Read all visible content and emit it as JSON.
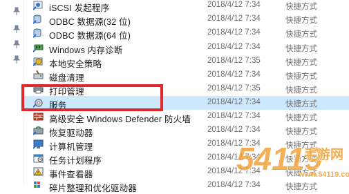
{
  "nav": {
    "pins": [
      "pin-icon",
      "pin-icon",
      "pin-icon",
      "pin-icon"
    ]
  },
  "files": [
    {
      "name": "iSCSI 发起程序",
      "date": "2018/4/12 7:34",
      "type": "快捷方式",
      "icon": "iscsi-icon",
      "selected": false
    },
    {
      "name": "ODBC 数据源(32 位)",
      "date": "2018/4/12 7:34",
      "type": "快捷方式",
      "icon": "odbc-icon",
      "selected": false
    },
    {
      "name": "ODBC 数据源(64 位)",
      "date": "2018/4/12 7:34",
      "type": "快捷方式",
      "icon": "odbc-icon",
      "selected": false
    },
    {
      "name": "Windows 内存诊断",
      "date": "2018/4/12 7:34",
      "type": "快捷方式",
      "icon": "memory-diagnostic-icon",
      "selected": false
    },
    {
      "name": "本地安全策略",
      "date": "2018/4/12 7:35",
      "type": "快捷方式",
      "icon": "security-policy-icon",
      "selected": false
    },
    {
      "name": "磁盘清理",
      "date": "2018/4/12 7:34",
      "type": "快捷方式",
      "icon": "disk-cleanup-icon",
      "selected": false
    },
    {
      "name": "打印管理",
      "date": "2018/4/12 7:35",
      "type": "快捷方式",
      "icon": "print-management-icon",
      "selected": false
    },
    {
      "name": "服务",
      "date": "2018/4/12 7:34",
      "type": "快捷方式",
      "icon": "services-icon",
      "selected": true
    },
    {
      "name": "高级安全 Windows Defender 防火墙",
      "date": "2018/4/12 7:34",
      "type": "快捷方式",
      "icon": "firewall-icon",
      "selected": false
    },
    {
      "name": "恢复驱动器",
      "date": "2018/4/12 7:34",
      "type": "快捷方式",
      "icon": "recovery-drive-icon",
      "selected": false
    },
    {
      "name": "计算机管理",
      "date": "2018/4/12 7:34",
      "type": "快捷方式",
      "icon": "computer-management-icon",
      "selected": false
    },
    {
      "name": "任务计划程序",
      "date": "2018/4/12 7:34",
      "type": "快捷方式",
      "icon": "task-scheduler-icon",
      "selected": false
    },
    {
      "name": "事件查看器",
      "date": "2018/4/12 7:34",
      "type": "快捷方式",
      "icon": "event-viewer-icon",
      "selected": false
    },
    {
      "name": "碎片整理和优化驱动器",
      "date": "2018/4/12 7:34",
      "type": "快捷方式",
      "icon": "defrag-icon",
      "selected": false
    }
  ],
  "watermark": {
    "logo": "54119",
    "site_cn": "手游网",
    "site_url": "www.54119.com"
  },
  "colors": {
    "selected_bg": "#cce8ff",
    "highlight": "#e0272b",
    "watermark": "#f2a23a"
  }
}
